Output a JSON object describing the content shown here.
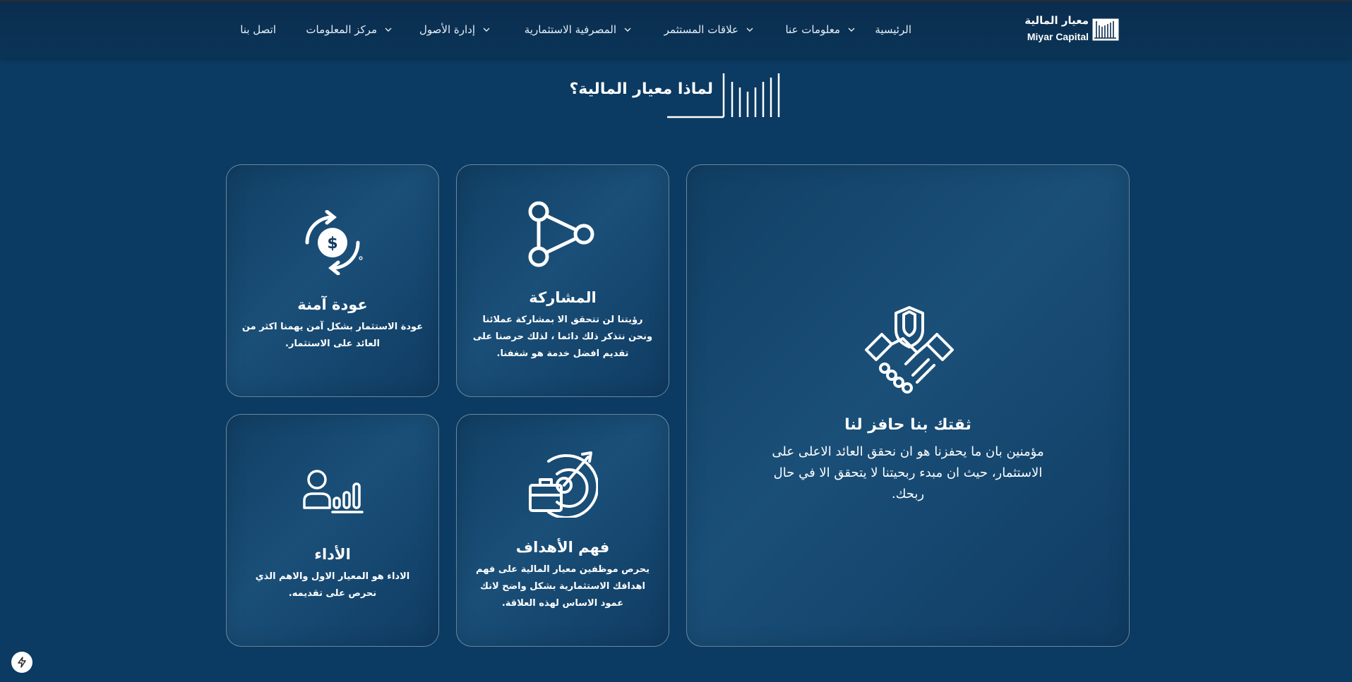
{
  "brand": {
    "name_ar": "معيار المالية",
    "name_en": "Miyar Capital"
  },
  "nav": {
    "items": [
      {
        "label": "الرئيسية",
        "dropdown": false
      },
      {
        "label": "معلومات عنا",
        "dropdown": true
      },
      {
        "label": "علاقات المستثمر",
        "dropdown": true
      },
      {
        "label": "المصرفية الاستثمارية",
        "dropdown": true
      },
      {
        "label": "إدارة الأصول",
        "dropdown": true
      },
      {
        "label": "مركز المعلومات",
        "dropdown": true
      },
      {
        "label": "اتصل بنا",
        "dropdown": false
      }
    ]
  },
  "section": {
    "title": "لماذا معيار المالية؟"
  },
  "cards": {
    "trust": {
      "title": "ثقتك بنا حافز لنا",
      "desc": "مؤمنين بان ما يحفزنا هو ان نحقق العائد الاعلى على الاستثمار، حيث ان مبدء ربحيتنا لا يتحقق الا في حال ربحك.",
      "icon": "handshake-shield-icon"
    },
    "participation": {
      "title": "المشاركة",
      "desc": "رؤيتنا لن تتحقق الا بمشاركة عملائنا ونحن نتذكر ذلك دائما ، لذلك حرصنا على تقديم افضل خدمة هو شغفنا.",
      "icon": "share-nodes-icon"
    },
    "safe_return": {
      "title": "عودة آمنة",
      "desc": "عودة الاستثمار بشكل آمن يهمنا اكثر من العائد على الاستثمار.",
      "icon": "dollar-cycle-icon"
    },
    "goals": {
      "title": "فهم الأهداف",
      "desc": "يحرص موظفين معيار المالية على فهم اهدافك الاستثمارية بشكل واضح لانك عمود الاساس لهذه العلاقة.",
      "icon": "target-briefcase-icon"
    },
    "performance": {
      "title": "الأداء",
      "desc": "الاداء هو المعيار الاول والاهم الذي نحرص على تقديمه.",
      "icon": "person-chart-icon"
    }
  },
  "colors": {
    "background": "#0b3a62",
    "header": "#0b2d4f",
    "card_border": "#8fa8c0",
    "text": "#ffffff"
  }
}
